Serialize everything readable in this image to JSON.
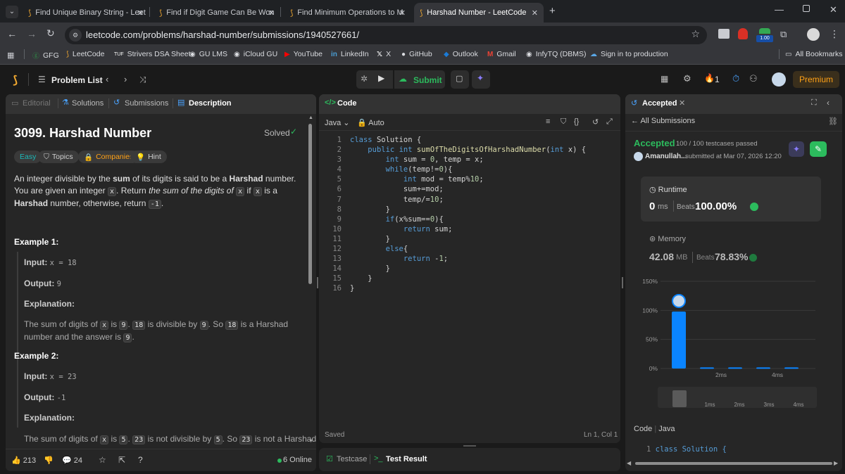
{
  "browser": {
    "tabs": [
      {
        "title": "Find Unique Binary String - Leet"
      },
      {
        "title": "Find if Digit Game Can Be Won"
      },
      {
        "title": "Find Minimum Operations to M"
      },
      {
        "title": "Harshad Number - LeetCode"
      }
    ],
    "url": "leetcode.com/problems/harshad-number/submissions/1940527661/",
    "extension_badge": "1.00",
    "bookmarks": [
      "GFG",
      "LeetCode",
      "Strivers DSA Sheet",
      "GU LMS",
      "iCloud GU",
      "YouTube",
      "LinkedIn",
      "X",
      "GitHub",
      "Outlook",
      "Gmail",
      "InfyTQ (DBMS)",
      "Sign in to production"
    ],
    "all_bookmarks": "All Bookmarks"
  },
  "lc_top": {
    "problem_list": "Problem List",
    "submit": "Submit",
    "streak": "1",
    "premium": "Premium"
  },
  "left_panel": {
    "tabs": {
      "editorial": "Editorial",
      "solutions": "Solutions",
      "submissions": "Submissions",
      "description": "Description"
    },
    "title": "3099. Harshad Number",
    "solved": "Solved",
    "tags": {
      "difficulty": "Easy",
      "topics": "Topics",
      "companies": "Companies",
      "hint": "Hint"
    },
    "desc": {
      "p1": "An integer divisible by the",
      "sum": "sum",
      "p2": "of its digits is said to be a",
      "harshad": "Harshad",
      "p3": "number. You",
      "l2a": "are given an integer",
      "x": "x",
      "l2b": ". Return",
      "l2c": "the sum of the digits of",
      "l2d": "if",
      "l2e": "is a",
      "l2f": "number,",
      "l3a": "otherwise, return",
      "neg1": "-1",
      "dot": "."
    },
    "ex1": {
      "title": "Example 1:",
      "input_label": "Input:",
      "input_val": "x = 18",
      "output_label": "Output:",
      "output_val": "9",
      "expl_label": "Explanation:",
      "e1": "The sum of digits of",
      "e2": "is",
      "v9": "9",
      "e3": ".",
      "v18": "18",
      "e4": "is divisible by",
      "e5": ". So",
      "e6": "is a Harshad number",
      "e7": "and the answer is"
    },
    "ex2": {
      "title": "Example 2:",
      "input_label": "Input:",
      "input_val": "x = 23",
      "output_label": "Output:",
      "output_val": "-1",
      "expl_label": "Explanation:",
      "e1": "The sum of digits of",
      "e2": "is",
      "v5": "5",
      "e3": ".",
      "v23": "23",
      "e4": "is not divisible by",
      "e5": ". So",
      "e6": "is not a Harshad"
    },
    "footer": {
      "likes": "213",
      "comments": "24",
      "online": "6 Online"
    }
  },
  "code_panel": {
    "title": "Code",
    "lang": "Java",
    "mode": "Auto",
    "status": "Saved",
    "cursor": "Ln 1, Col 1",
    "lines": [
      "1",
      "2",
      "3",
      "4",
      "5",
      "6",
      "7",
      "8",
      "9",
      "10",
      "11",
      "12",
      "13",
      "14",
      "15",
      "16"
    ],
    "bottom": {
      "testcase": "Testcase",
      "result": "Test Result"
    }
  },
  "result_panel": {
    "tab": "Accepted",
    "back": "All Submissions",
    "status": "Accepted",
    "testcases": "100 / 100 testcases passed",
    "user": "Amanullah...",
    "submitted": "submitted at Mar 07, 2026 12:20",
    "runtime_label": "Runtime",
    "runtime_val": "0",
    "runtime_unit": "ms",
    "runtime_beats_label": "Beats",
    "runtime_beats": "100.00%",
    "memory_label": "Memory",
    "memory_val": "42.08",
    "memory_unit": "MB",
    "memory_beats_label": "Beats",
    "memory_beats": "78.83%",
    "code_label": "Code",
    "code_lang": "Java",
    "code_preview_line": "1",
    "code_preview": "class Solution {"
  },
  "chart_data": {
    "type": "bar",
    "y_ticks": [
      "150%",
      "100%",
      "50%",
      "0%"
    ],
    "ylim": [
      0,
      150
    ],
    "x_ticks": [
      "2ms",
      "4ms"
    ],
    "categories": [
      "0ms",
      "1ms",
      "2ms",
      "3ms",
      "4ms"
    ],
    "values": [
      98,
      2,
      2,
      2,
      2
    ],
    "mini_ticks": [
      "1ms",
      "2ms",
      "3ms",
      "4ms"
    ],
    "accent": "#0a84ff"
  },
  "colors": {
    "accent": "#0a84ff",
    "easy": "#1cb8b8",
    "accepted": "#2cbb5d",
    "premium": "#ffa116"
  }
}
